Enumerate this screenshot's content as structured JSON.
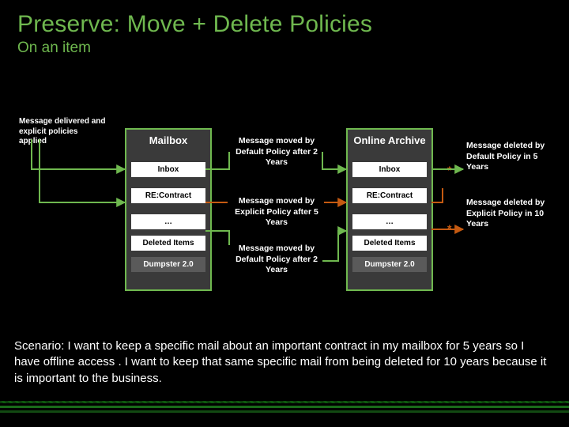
{
  "title": "Preserve: Move + Delete Policies",
  "subtitle": "On an item",
  "delivered": "Message delivered and explicit policies applied",
  "mailbox": {
    "header": "Mailbox",
    "inbox": "Inbox",
    "reContract": "RE:Contract",
    "ellipsis": "…",
    "deletedItems": "Deleted Items",
    "dumpster": "Dumpster 2.0"
  },
  "archive": {
    "header": "Online Archive",
    "inbox": "Inbox",
    "reContract": "RE:Contract",
    "ellipsis": "…",
    "deletedItems": "Deleted Items",
    "dumpster": "Dumpster 2.0"
  },
  "captions": {
    "moveDefault2": "Message moved by Default Policy after 2 Years",
    "moveExplicit5": "Message moved by Explicit Policy after 5 Years",
    "moveDefault2b": "Message moved by Default Policy after 2 Years"
  },
  "rightNotes": {
    "deleteDefault5": "Message deleted by Default Policy in 5 Years",
    "deleteExplicit10": "Message deleted by Explicit Policy in 10 Years"
  },
  "star": "*",
  "scenario": "Scenario: I want to keep a specific mail about an important contract in my mailbox for 5 years so I have offline access . I want to keep that same specific mail from being deleted for 10 years because it is important to the business.",
  "colors": {
    "accent": "#6fb84f",
    "orange": "#c55a11"
  }
}
